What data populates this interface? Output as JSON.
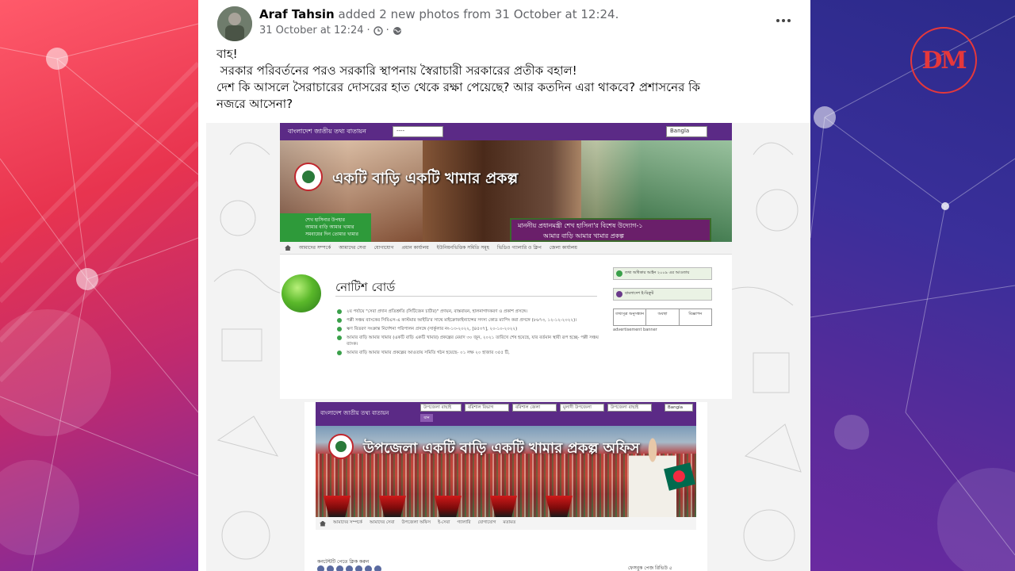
{
  "post": {
    "author": "Araf Tahsin",
    "action": "added 2 new photos from 31 October at 12:24.",
    "timestamp": "31 October at 12:24",
    "separator": "·",
    "text_lines": [
      "বাহ!",
      " সরকার পরিবর্তনের পরও সরকারি স্থাপনায় স্বৈরাচারী সরকারের প্রতীক বহাল!",
      "দেশ কি আসলে সৈরাচারের দোসরের হাত থেকে রক্ষা পেয়েছে? আর কতদিন এরা থাকবে? প্রশাসনের কি",
      "নজরে আসেনা?"
    ]
  },
  "watermark": {
    "logo_text": "DM",
    "color": "#e5383b"
  },
  "photo1": {
    "site_title": "বাংলাদেশ জাতীয় তথ্য বাতায়ন",
    "select_placeholder": "----",
    "language": "Bangla",
    "banner_title": "একটি বাড়ি একটি খামার প্রকল্প",
    "left_box": [
      "শেখ হাসিনার উপহার",
      "আমার বাড়ি আমার খামার",
      "সমবায়ের দিন তোমার খামার"
    ],
    "purple_line1": "মাননীয় প্রধানমন্ত্রী শেখ হাসিনা'র বিশেষ উদ্যোগ-১",
    "purple_line2": "আমার বাড়ি আমার খামার প্রকল্প",
    "menu": [
      "আমাদের সম্পর্কে",
      "আমাদের সেবা",
      "যোগাযোগ",
      "প্রধান কার্যালয়",
      "ইউনিয়নভিত্তিক সমিতি সমূহ",
      "ভিডিও গ্যালারি ও ক্লিপ",
      "জেলা কার্যালয়"
    ],
    "notice_title": "নোটিশ বোর্ড",
    "notices": [
      "২য় পর্যায়ে \"সেবা প্রদান প্রতিশ্রুতি (সিটিজেন চার্টার)\" প্রণয়ন, বাস্তবায়ন, হালনাগাদকরণ ও প্রকাশ প্রসঙ্গে।",
      "পল্লী সঞ্চয় ব্যাংকের সিবিএস-এ কাস্টমার আইডি'র সাথে মাইক্রোফাইন্যান্সের সদস্য কোড ম্যাপিং করা প্রসঙ্গে (৮৬৭৩, ১২-১২-২০২২)।",
      "ঋণ বিতরণ সংক্রান্ত নির্দেশনা পরিপালন প্রসঙ্গে (সার্কুলার নং-১৩-২০২২, [৪৫৩৭], ২০-১০-২০২২)",
      "আমার বাড়ি আমার খামার (একটি বাড়ি একটি খামার) প্রকল্পের মেয়াদ ৩০ জুন, ২০২১ তারিখে শেষ হয়েছে, যার বর্তমান স্থায়ী রূপ হচ্ছে- পল্লী সঞ্চয় ব্যাংক।",
      "আমার বাড়ি আমার খামার প্রকল্পের আওতায় সমিতি গঠন হয়েছে- ০১ লক্ষ ২০ হাজার ৩৫৫ টি,"
    ],
    "side_buttons": [
      "তথ্য অধিকার আইন ২০০৯ এর আওতায়",
      "বাংলাদেশ ই-রিক্রুট"
    ],
    "side_table": [
      "তথ্যসূত্র অনুসন্ধান",
      "অবস্থা",
      "বিজ্ঞাপন"
    ],
    "adv_text": "advertisement banner"
  },
  "photo2": {
    "site_title": "বাংলাদেশ জাতীয় তথ্য বাতায়ন",
    "selects": [
      "উপজেলা বাছাই",
      "বরিশাল বিভাগ",
      "বরিশাল জেলা",
      "মুলাদী উপজেলা",
      "উপজেলা বাছাই"
    ],
    "go": "যান",
    "language": "Bangla",
    "banner_title": "উপজেলা একটি বাড়ি একটি খামার প্রকল্প অফিস",
    "menu": [
      "আমাদের সম্পর্কে",
      "আমাদের সেবা",
      "উপজেলা অফিস",
      "ই-সেবা",
      "গ্যালারি",
      "যোগাযোগ",
      "মতামত"
    ],
    "footer_left": "কনটেন্টটি পেতে ক্লিক করুন",
    "footer_right": "ফেসবুক পেজ রিভিউ ৫"
  }
}
